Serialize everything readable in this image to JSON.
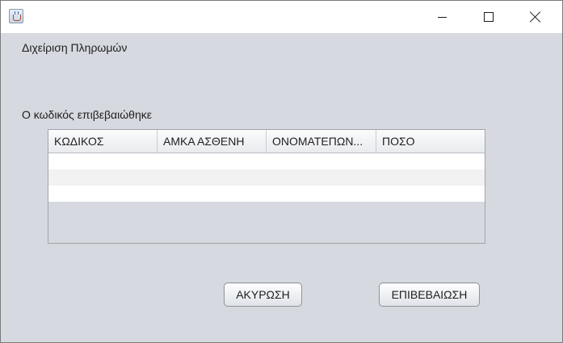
{
  "window": {
    "title": "",
    "controls": {
      "minimize": "minimize",
      "maximize": "maximize",
      "close": "close"
    }
  },
  "main": {
    "title": "Διχείριση Πληρωμών",
    "status": "Ο κωδικός επιβεβαιώθηκε"
  },
  "table": {
    "columns": [
      "ΚΩΔΙΚΟΣ",
      "ΑΜΚΑ ΑΣΘΕΝΗ",
      "ΟΝΟΜΑΤΕΠΩΝ...",
      "ΠΟΣΟ"
    ],
    "rows": [
      [
        "",
        "",
        "",
        ""
      ],
      [
        "",
        "",
        "",
        ""
      ],
      [
        "",
        "",
        "",
        ""
      ]
    ]
  },
  "buttons": {
    "cancel_label": "ΑΚΥΡΩΣΗ",
    "confirm_label": "ΕΠΙΒΕΒΑΙΩΣΗ"
  },
  "colors": {
    "panel_background": "#d6d9df",
    "titlebar_background": "#ffffff",
    "row_alt": "#f2f2f2"
  }
}
